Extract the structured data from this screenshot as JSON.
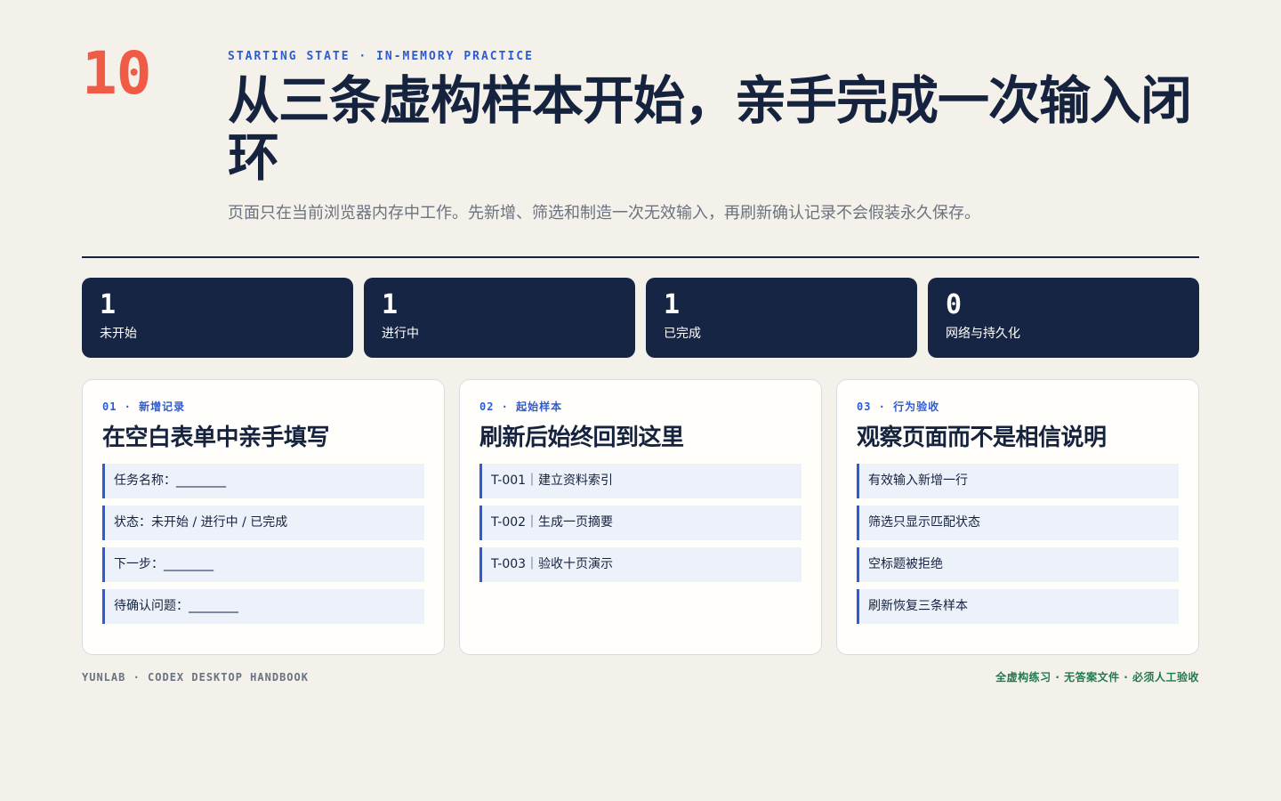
{
  "slide_number": "10",
  "eyebrow": "STARTING STATE · IN-MEMORY PRACTICE",
  "title": "从三条虚构样本开始，亲手完成一次输入闭环",
  "subtitle": "页面只在当前浏览器内存中工作。先新增、筛选和制造一次无效输入，再刷新确认记录不会假装永久保存。",
  "stats": [
    {
      "value": "1",
      "label": "未开始"
    },
    {
      "value": "1",
      "label": "进行中"
    },
    {
      "value": "1",
      "label": "已完成"
    },
    {
      "value": "0",
      "label": "网络与持久化"
    }
  ],
  "cards": [
    {
      "tag": "01 · 新增记录",
      "title": "在空白表单中亲手填写",
      "items": [
        "任务名称：________",
        "状态：未开始 / 进行中 / 已完成",
        "下一步：________",
        "待确认问题：________"
      ]
    },
    {
      "tag": "02 · 起始样本",
      "title": "刷新后始终回到这里",
      "items": [
        "T-001｜建立资料索引",
        "T-002｜生成一页摘要",
        "T-003｜验收十页演示"
      ]
    },
    {
      "tag": "03 · 行为验收",
      "title": "观察页面而不是相信说明",
      "items": [
        "有效输入新增一行",
        "筛选只显示匹配状态",
        "空标题被拒绝",
        "刷新恢复三条样本"
      ]
    }
  ],
  "footer": {
    "left": "YUNLAB · CODEX DESKTOP HANDBOOK",
    "right": "全虚构练习 · 无答案文件 · 必须人工验收"
  },
  "colors": {
    "background": "#f4f0ea",
    "navy": "#172544",
    "accent_blue": "#2d5bd3",
    "accent_red": "#ef5b45",
    "footer_green": "#1f7a4d"
  }
}
